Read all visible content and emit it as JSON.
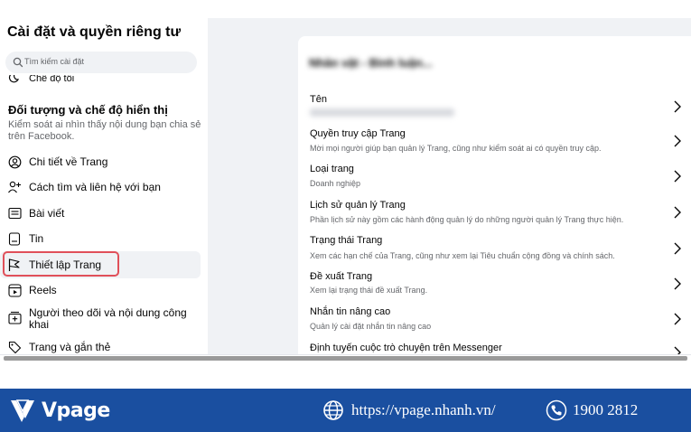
{
  "sidebar": {
    "title": "Cài đặt và quyền riêng tư",
    "search_placeholder": "Tìm kiếm cài đặt",
    "cut_item": "Chế độ tối",
    "section_title": "Đối tượng và chế độ hiển thị",
    "section_desc": "Kiểm soát ai nhìn thấy nội dung bạn chia sẻ trên Facebook.",
    "items": [
      {
        "label": "Chi tiết về Trang",
        "icon": "person-circle-icon"
      },
      {
        "label": "Cách tìm và liên hệ với bạn",
        "icon": "person-add-icon"
      },
      {
        "label": "Bài viết",
        "icon": "post-icon"
      },
      {
        "label": "Tin",
        "icon": "story-icon"
      },
      {
        "label": "Thiết lập Trang",
        "icon": "flag-icon"
      },
      {
        "label": "Reels",
        "icon": "reels-icon"
      },
      {
        "label": "Người theo dõi và nội dung công khai",
        "label_line2": "khai",
        "icon": "followers-icon"
      },
      {
        "label": "Trang và gắn thẻ",
        "icon": "tag-icon"
      }
    ]
  },
  "main": {
    "header_blurred": "Nhân vật - Bình luận...",
    "rows": [
      {
        "title": "Tên",
        "desc": ""
      },
      {
        "title": "Quyền truy cập Trang",
        "desc": "Mời mọi người giúp bạn quản lý Trang, cũng như kiểm soát ai có quyền truy cập."
      },
      {
        "title": "Loại trang",
        "desc": "Doanh nghiệp"
      },
      {
        "title": "Lịch sử quản lý Trang",
        "desc": "Phần lịch sử này gồm các hành động quản lý do những người quản lý Trang thực hiện."
      },
      {
        "title": "Trạng thái Trang",
        "desc": "Xem các hạn chế của Trang, cũng như xem lại Tiêu chuẩn cộng đồng và chính sách."
      },
      {
        "title": "Đề xuất Trang",
        "desc": "Xem lại trạng thái đề xuất Trang."
      },
      {
        "title": "Nhắn tin nâng cao",
        "desc": "Quản lý cài đặt nhắn tin nâng cao"
      },
      {
        "title": "Định tuyến cuộc trò chuyện trên Messenger",
        "desc": ""
      }
    ]
  },
  "footer": {
    "brand": "Vpage",
    "website": "https://vpage.nhanh.vn/",
    "phone": "1900 2812",
    "bg_color": "#1a4fa0"
  },
  "colors": {
    "highlight": "#e0505a",
    "secondary_text": "#65676b",
    "page_bg": "#f0f2f5"
  }
}
